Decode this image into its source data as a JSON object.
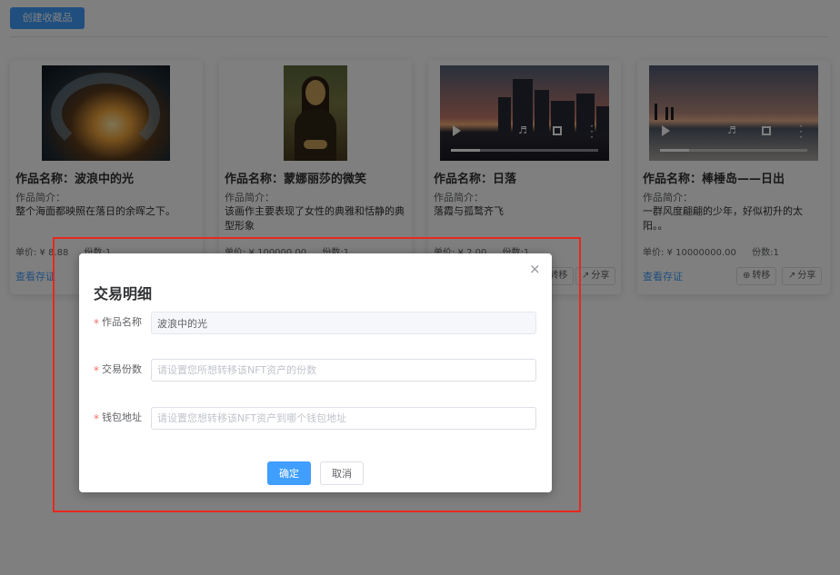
{
  "toolbar": {
    "create_label": "创建收藏品"
  },
  "cards": [
    {
      "title": "作品名称：波浪中的光",
      "intro_label": "作品简介：",
      "intro": "整个海面都映照在落日的余晖之下。",
      "price": "单价: ¥ 8.88",
      "shares": "份数:1",
      "proof_link": "查看存证",
      "thumb": "wave-image"
    },
    {
      "title": "作品名称：蒙娜丽莎的微笑",
      "intro_label": "作品简介：",
      "intro": "该画作主要表现了女性的典雅和恬静的典型形象",
      "price": "单价: ¥ 100000.00",
      "shares": "份数:1",
      "thumb": "mona-lisa-image"
    },
    {
      "title": "作品名称：日落",
      "intro_label": "作品简介：",
      "intro": "落霞与孤鹜齐飞",
      "price": "单价: ¥ 2.00",
      "shares": "份数:1",
      "transfer_label": "转移",
      "share_label": "分享",
      "thumb": "sunset-video"
    },
    {
      "title": "作品名称：棒棰岛——日出",
      "intro_label": "作品简介：",
      "intro": "一群风度翩翩的少年，好似初升的太阳。。",
      "price": "单价: ¥ 10000000.00",
      "shares": "份数:1",
      "proof_link": "查看存证",
      "transfer_label": "转移",
      "share_label": "分享",
      "thumb": "sunrise-video"
    }
  ],
  "dialog": {
    "title": "交易明细",
    "fields": [
      {
        "label": "作品名称",
        "value": "波浪中的光",
        "disabled": true
      },
      {
        "label": "交易份数",
        "placeholder": "请设置您所想转移该NFT资产的份数"
      },
      {
        "label": "钱包地址",
        "placeholder": "请设置您想转移该NFT资产到哪个钱包地址"
      }
    ],
    "ok_label": "确定",
    "cancel_label": "取消",
    "close_icon": "×",
    "required_mark": "*"
  },
  "colors": {
    "primary": "#409eff",
    "highlight": "#e8281e",
    "required": "#f56c6c"
  }
}
